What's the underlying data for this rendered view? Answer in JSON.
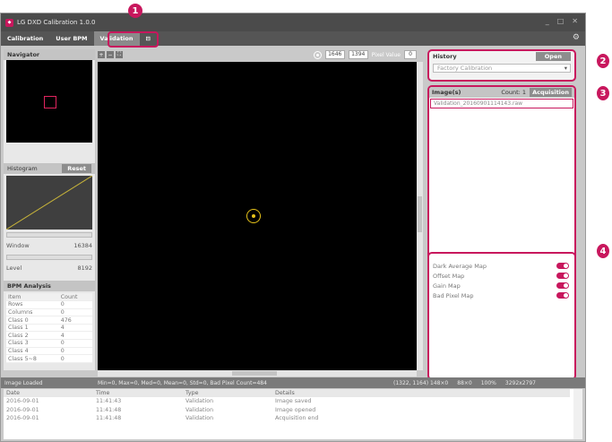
{
  "window": {
    "title": "LG DXD Calibration 1.0.0",
    "controls": [
      "_",
      "□",
      "✕"
    ]
  },
  "menu": {
    "items": [
      "Calibration",
      "User BPM",
      "Validation",
      "⊟"
    ],
    "active_index": 2
  },
  "navigator": {
    "title": "Navigator"
  },
  "histogram": {
    "title": "Histogram",
    "reset_label": "Reset",
    "window_label": "Window",
    "window_value": "16384",
    "level_label": "Level",
    "level_value": "8192"
  },
  "bpm": {
    "title": "BPM Analysis",
    "headers": [
      "Item",
      "Count"
    ],
    "rows": [
      [
        "Rows",
        "0"
      ],
      [
        "Columns",
        "0"
      ],
      [
        "Class 0",
        "476"
      ],
      [
        "Class 1",
        "4"
      ],
      [
        "Class 2",
        "4"
      ],
      [
        "Class 3",
        "0"
      ],
      [
        "Class 4",
        "0"
      ],
      [
        "Class 5~8",
        "0"
      ]
    ]
  },
  "toolbar": {
    "coord_x": "1646",
    "coord_y": "1394",
    "pixel_label": "Pixel Value",
    "pixel_value": "0"
  },
  "history": {
    "title": "History",
    "open_label": "Open",
    "selected": "Factory Calibration"
  },
  "images": {
    "title": "Image(s)",
    "count_label": "Count: 1",
    "acq_label": "Acquisition",
    "items": [
      "Validation_20160901114143.raw"
    ]
  },
  "maps": {
    "items": [
      "Dark Average Map",
      "Offset Map",
      "Gain Map",
      "Bad Pixel Map"
    ]
  },
  "status": {
    "state": "Image Loaded",
    "stats": "Min=0, Max=0, Med=0, Mean=0, Std=0, Bad Pixel Count=484",
    "pos": "(1322, 1164) 148×0",
    "bits": "88×0",
    "zoom": "100%",
    "size": "3292x2797"
  },
  "log": {
    "headers": [
      "Date",
      "Time",
      "Type",
      "Details"
    ],
    "rows": [
      [
        "2016-09-01",
        "11:41:43",
        "Validation",
        "Image saved"
      ],
      [
        "2016-09-01",
        "11:41:48",
        "Validation",
        "Image opened"
      ],
      [
        "2016-09-01",
        "11:41:48",
        "Validation",
        "Acquisition end"
      ]
    ]
  },
  "callouts": [
    "1",
    "2",
    "3",
    "4"
  ],
  "colors": {
    "accent": "#c8175d",
    "crosshair": "#e6c21a",
    "titlebar": "#4b4b4b"
  }
}
